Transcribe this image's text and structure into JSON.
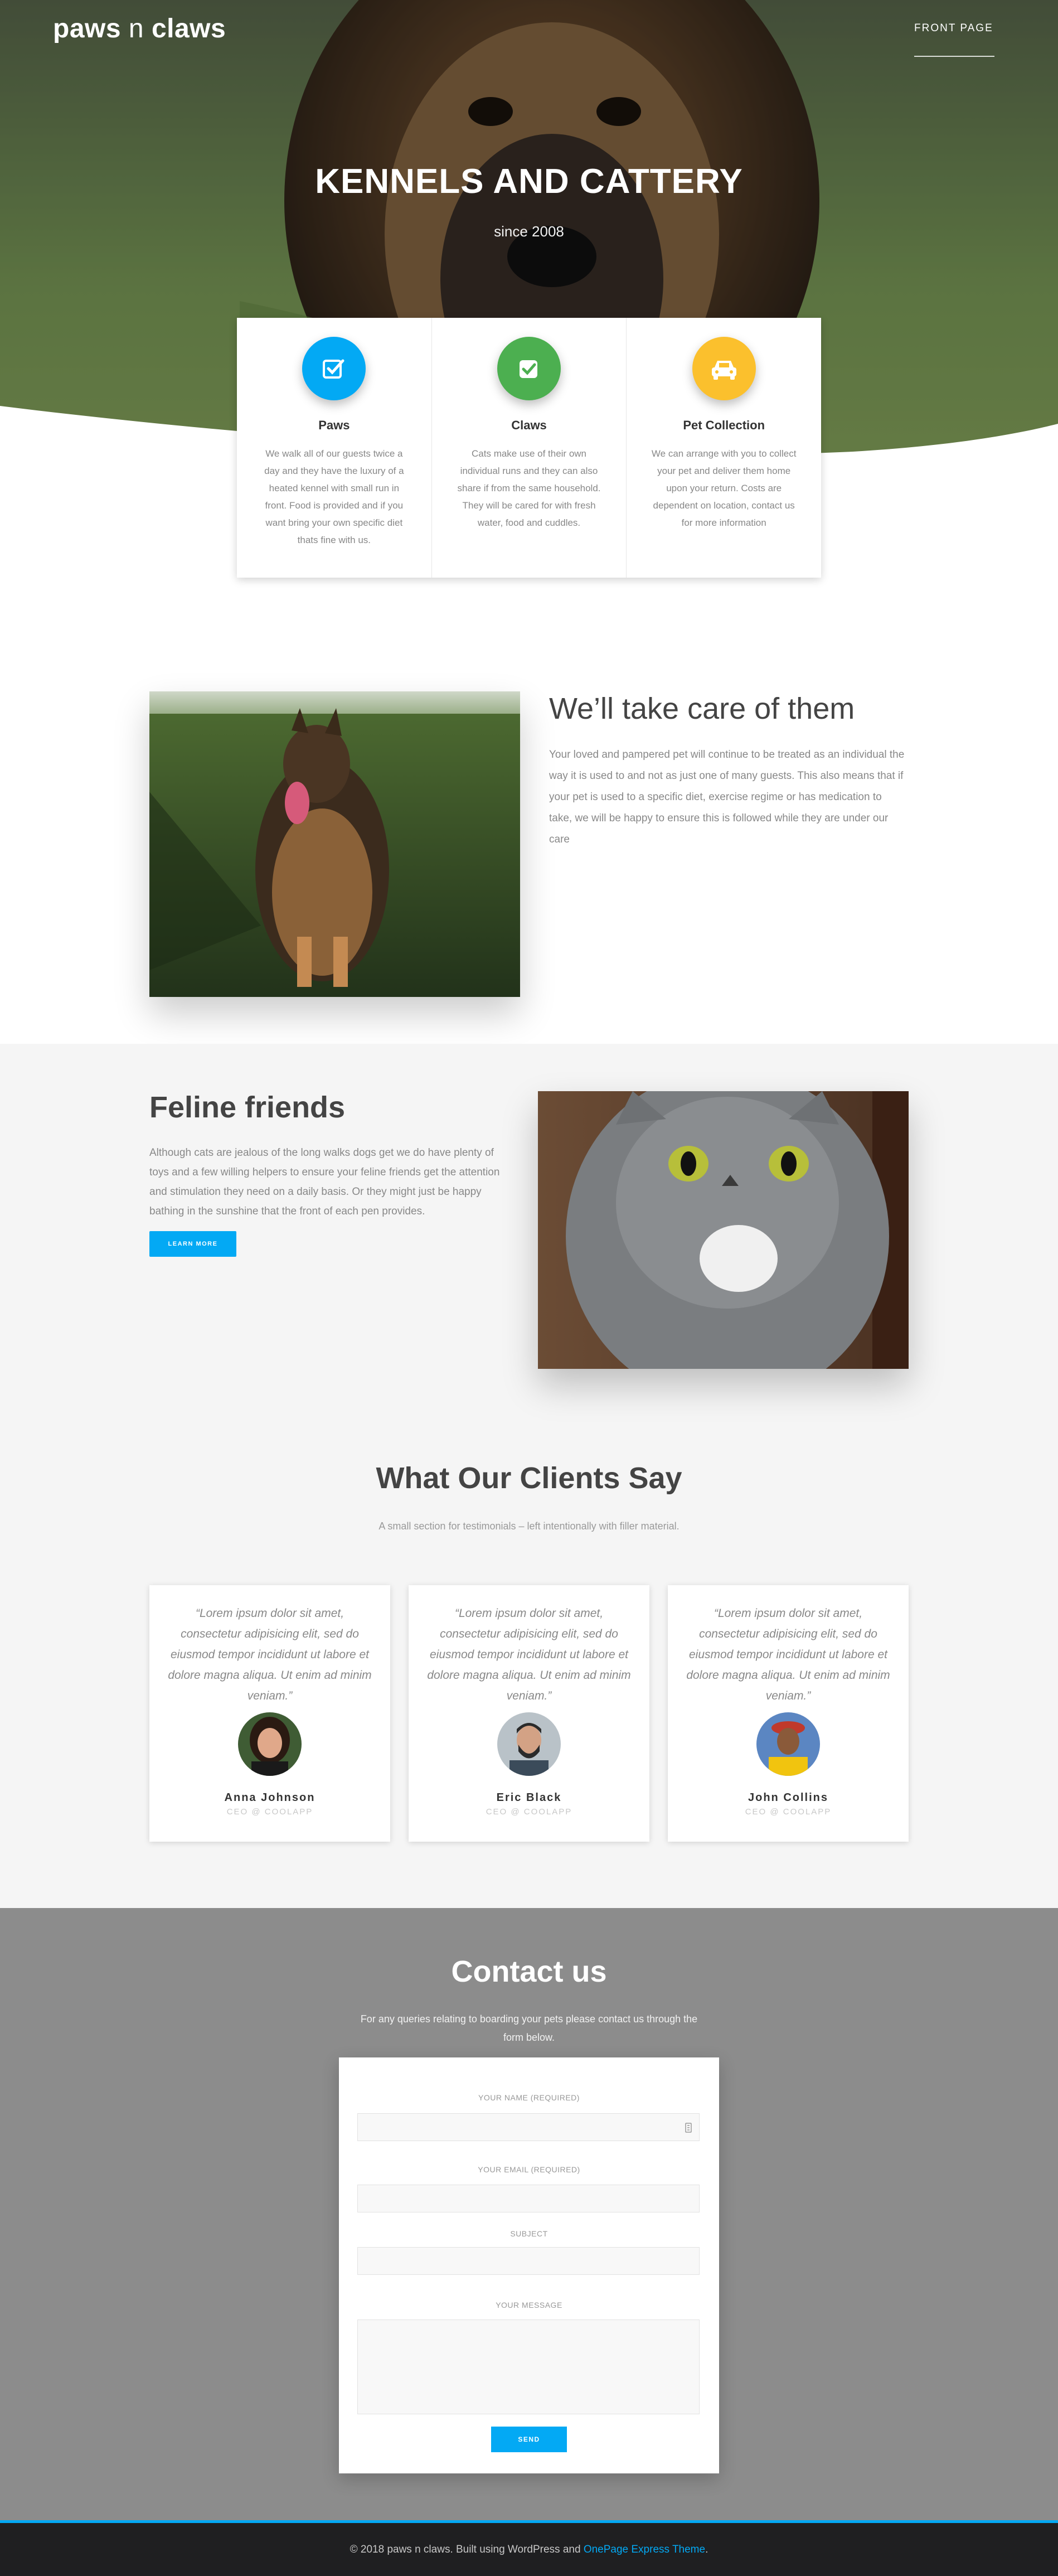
{
  "header": {
    "logo_bold1": "paws",
    "logo_thin": "n",
    "logo_bold2": "claws",
    "nav": [
      "FRONT PAGE"
    ]
  },
  "hero": {
    "title": "KENNELS AND CATTERY",
    "subtitle": "since 2008"
  },
  "features": [
    {
      "icon": "checkbox-pencil-icon",
      "color": "#03a9f4",
      "title": "Paws",
      "text": "We walk all of our guests twice a day and they have the luxury of a heated kennel with small run in front. Food is provided and if you want bring your own specific diet thats fine with us."
    },
    {
      "icon": "checkbox-icon",
      "color": "#4caf50",
      "title": "Claws",
      "text": "Cats make use of their own individual runs and they can also share if from the same household. They will be cared for with fresh water, food and cuddles."
    },
    {
      "icon": "car-icon",
      "color": "#fbc02d",
      "title": "Pet Collection",
      "text": "We can arrange with you to collect your pet and deliver them home upon your return. Costs are dependent on location, contact us for more information"
    }
  ],
  "about": {
    "title": "We’ll take care of them",
    "text": "Your loved and pampered pet will continue to be treated as an individual the way it is used to and not as just one of many guests. This also means that if your pet is used to a specific diet, exercise regime or has medication to take, we will be happy to ensure this is followed while they are under our care"
  },
  "feline": {
    "title": "Feline friends",
    "text": "Although cats are jealous of the long walks dogs get we do have plenty of toys and a few willing helpers to ensure your feline friends get the attention and stimulation they need on a daily basis. Or they might just be happy bathing in the sunshine that the front of each pen provides.",
    "button": "LEARN MORE"
  },
  "testimonials": {
    "title": "What Our Clients Say",
    "subtitle": "A small section for testimonials – left intentionally with filler material.",
    "items": [
      {
        "quote": "“Lorem ipsum dolor sit amet, consectetur adipisicing elit, sed do eiusmod tempor incididunt ut labore et dolore magna aliqua. Ut enim ad minim veniam.”",
        "name": "Anna Johnson",
        "role": "CEO @ COOLAPP"
      },
      {
        "quote": "“Lorem ipsum dolor sit amet, consectetur adipisicing elit, sed do eiusmod tempor incididunt ut labore et dolore magna aliqua. Ut enim ad minim veniam.”",
        "name": "Eric Black",
        "role": "CEO @ COOLAPP"
      },
      {
        "quote": "“Lorem ipsum dolor sit amet, consectetur adipisicing elit, sed do eiusmod tempor incididunt ut labore et dolore magna aliqua. Ut enim ad minim veniam.”",
        "name": "John Collins",
        "role": "CEO @ COOLAPP"
      }
    ]
  },
  "contact": {
    "title": "Contact us",
    "subtitle": "For any queries relating to boarding your pets please contact us through the form below.",
    "fields": {
      "name_label": "YOUR NAME (REQUIRED)",
      "name_value": "",
      "email_label": "YOUR EMAIL (REQUIRED)",
      "email_value": "",
      "subject_label": "SUBJECT",
      "subject_value": "",
      "message_label": "YOUR MESSAGE",
      "message_value": ""
    },
    "send": "SEND"
  },
  "footer": {
    "text": "© 2018 paws n claws. Built using WordPress and ",
    "link": "OnePage Express Theme",
    "end": "."
  },
  "colors": {
    "accent": "#03a9f4",
    "green": "#4caf50",
    "yellow": "#fbc02d",
    "contact_bg": "#8c8c8c",
    "footer_bg": "#1f1f21"
  }
}
